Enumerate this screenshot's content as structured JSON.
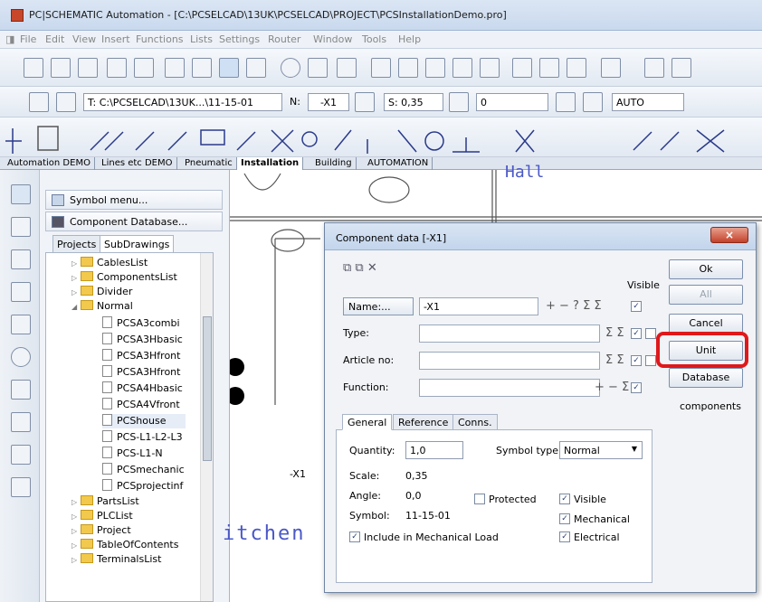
{
  "window": {
    "title": "PC|SCHEMATIC Automation - [C:\\PCSELCAD\\13UK\\PCSELCAD\\PROJECT\\PCSInstallationDemo.pro]"
  },
  "menu": [
    "File",
    "Edit",
    "View",
    "Insert",
    "Functions",
    "Lists",
    "Settings",
    "Router",
    "Window",
    "Tools",
    "Help"
  ],
  "toolbar2": {
    "path_field": "T: C:\\PCSELCAD\\13UK...\\11-15-01",
    "n_label": "N:",
    "n_value": "-X1",
    "scale_field": "S: 0,35",
    "angle_value": "0",
    "auto_value": "AUTO"
  },
  "symbol_tabs": [
    "Automation DEMO",
    "Lines etc DEMO",
    "Pneumatic",
    "Installation",
    "Building",
    "AUTOMATION"
  ],
  "panel": {
    "symbol_menu": "Symbol menu...",
    "component_db": "Component Database...",
    "tabs": [
      "Projects",
      "SubDrawings"
    ],
    "tree": [
      {
        "label": "CablesList",
        "kind": "folder",
        "level": 0
      },
      {
        "label": "ComponentsList",
        "kind": "folder",
        "level": 0
      },
      {
        "label": "Divider",
        "kind": "folder",
        "level": 0
      },
      {
        "label": "Normal",
        "kind": "folder",
        "level": 0,
        "open": true
      },
      {
        "label": "PCSA3combi",
        "kind": "doc",
        "level": 1
      },
      {
        "label": "PCSA3Hbasic",
        "kind": "doc",
        "level": 1
      },
      {
        "label": "PCSA3Hfront",
        "kind": "doc",
        "level": 1
      },
      {
        "label": "PCSA3Hfront",
        "kind": "doc",
        "level": 1
      },
      {
        "label": "PCSA4Hbasic",
        "kind": "doc",
        "level": 1
      },
      {
        "label": "PCSA4Vfront",
        "kind": "doc",
        "level": 1
      },
      {
        "label": "PCShouse",
        "kind": "doc",
        "level": 1
      },
      {
        "label": "PCS-L1-L2-L3",
        "kind": "doc",
        "level": 1
      },
      {
        "label": "PCS-L1-N",
        "kind": "doc",
        "level": 1
      },
      {
        "label": "PCSmechanic",
        "kind": "doc",
        "level": 1
      },
      {
        "label": "PCSprojectinf",
        "kind": "doc",
        "level": 1
      },
      {
        "label": "PartsList",
        "kind": "folder",
        "level": 0
      },
      {
        "label": "PLCList",
        "kind": "folder",
        "level": 0
      },
      {
        "label": "Project",
        "kind": "folder",
        "level": 0
      },
      {
        "label": "TableOfContents",
        "kind": "folder",
        "level": 0
      },
      {
        "label": "TerminalsList",
        "kind": "folder",
        "level": 0
      }
    ]
  },
  "canvas": {
    "room_label": "itchen",
    "hall_label": "Hall",
    "x1_label": "-X1"
  },
  "dialog": {
    "title": "Component data [-X1]",
    "visible_header": "Visible",
    "name_label": "Name:...",
    "name_value": "-X1",
    "type_label": "Type:",
    "article_label": "Article no:",
    "function_label": "Function:",
    "buttons": {
      "ok": "Ok",
      "all": "All",
      "cancel": "Cancel",
      "unit": "Unit",
      "database": "Database"
    },
    "components_label": "components",
    "tabs": [
      "General",
      "Reference",
      "Conns."
    ],
    "general": {
      "quantity_label": "Quantity:",
      "quantity_value": "1,0",
      "symbol_type_label": "Symbol type",
      "symbol_type_value": "Normal",
      "scale_label": "Scale:",
      "scale_value": "0,35",
      "angle_label": "Angle:",
      "angle_value": "0,0",
      "protected_label": "Protected",
      "symbol_label": "Symbol:",
      "symbol_value": "11-15-01",
      "visible_label": "Visible",
      "mechanical_label": "Mechanical",
      "electrical_label": "Electrical",
      "mech_load_label": "Include in Mechanical Load"
    }
  },
  "colors": {
    "highlight": "#e0181b",
    "titlebar": "#c9d9ee",
    "folder": "#f2c94c"
  }
}
